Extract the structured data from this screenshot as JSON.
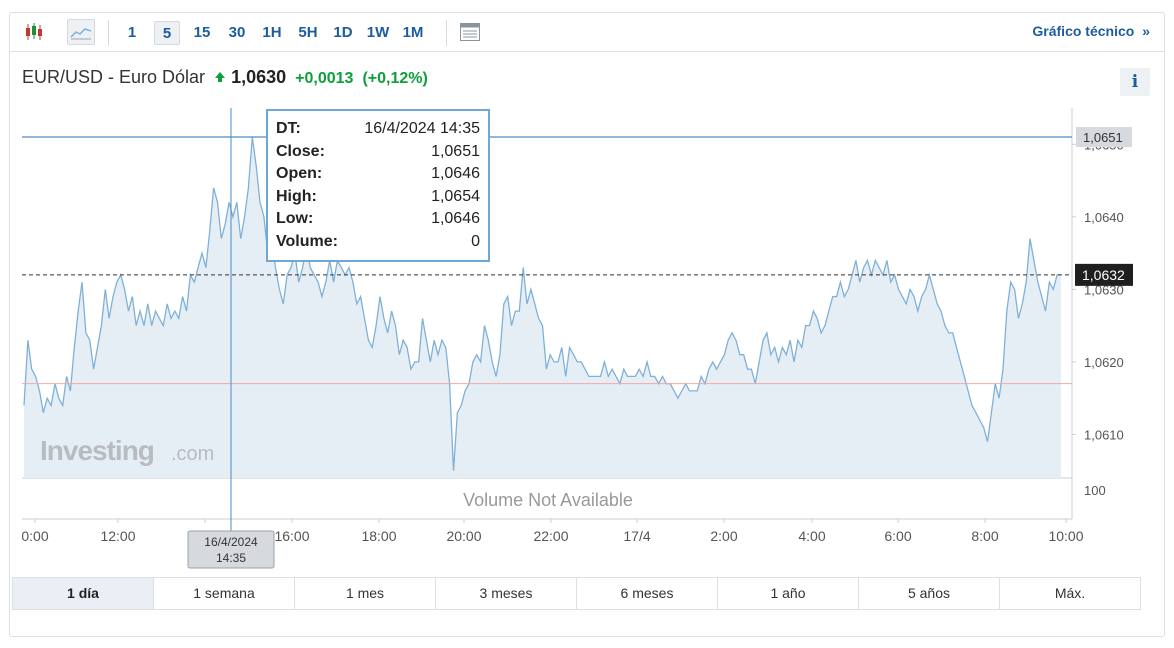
{
  "toolbar": {
    "icons": [
      "candlestick-icon",
      "area-chart-icon",
      "indicators-icon"
    ],
    "timeframes": [
      "1",
      "5",
      "15",
      "30",
      "1H",
      "5H",
      "1D",
      "1W",
      "1M"
    ],
    "active_timeframe": "5",
    "technical_link": "Gráfico técnico",
    "technical_arrow": "»"
  },
  "header": {
    "instrument": "EUR/USD - Euro Dólar",
    "price": "1,0630",
    "change": "+0,0013",
    "change_pct": "(+0,12%)",
    "info_label": "i"
  },
  "watermark": {
    "brand": "Investing",
    "suffix": ".com"
  },
  "volume_label": "Volume Not Available",
  "tooltip": {
    "rows": [
      {
        "k": "DT:",
        "v": "16/4/2024 14:35"
      },
      {
        "k": "Close:",
        "v": "1,0651"
      },
      {
        "k": "Open:",
        "v": "1,0646"
      },
      {
        "k": "High:",
        "v": "1,0654"
      },
      {
        "k": "Low:",
        "v": "1,0646"
      },
      {
        "k": "Volume:",
        "v": "0"
      }
    ]
  },
  "crosshair_label": {
    "date": "16/4/2024",
    "time": "14:35"
  },
  "range_tabs": [
    "1 día",
    "1 semana",
    "1 mes",
    "3 meses",
    "6 meses",
    "1 año",
    "5 años",
    "Máx."
  ],
  "active_range": "1 día",
  "colors": {
    "line": "#7fb1d8",
    "fill": "#e6eef5",
    "crosshair": "#4a8cc4",
    "prev_close": "#f2a8a8",
    "accent": "#1d5c9f",
    "up": "#0e9e3a"
  },
  "chart_data": {
    "type": "area",
    "y_ticks": [
      "1,0610",
      "1,0620",
      "1,0630",
      "1,0640",
      "1,0650"
    ],
    "ylim": [
      1.0604,
      1.0655
    ],
    "volume_tick": "100",
    "x_ticks": [
      {
        "label": "0:00",
        "hours": 0
      },
      {
        "label": "12:00",
        "hours": 12
      },
      {
        "label": "14:00",
        "hours": 14
      },
      {
        "label": "16:00",
        "hours": 16
      },
      {
        "label": "18:00",
        "hours": 18
      },
      {
        "label": "20:00",
        "hours": 20
      },
      {
        "label": "22:00",
        "hours": 22
      },
      {
        "label": "17/4",
        "hours": 24
      },
      {
        "label": "2:00",
        "hours": 26
      },
      {
        "label": "4:00",
        "hours": 28
      },
      {
        "label": "6:00",
        "hours": 30
      },
      {
        "label": "8:00",
        "hours": 32
      },
      {
        "label": "10:00",
        "hours": 34
      }
    ],
    "crosshair_hours": 14.583,
    "crosshair_value": 1.0651,
    "crosshair_value_label": "1,0651",
    "current_value": 1.0632,
    "current_value_label": "1,0632",
    "prev_close_value": 1.0617,
    "series": [
      {
        "values": [
          1.0614,
          1.0623,
          1.0619,
          1.0618,
          1.0616,
          1.0613,
          1.0615,
          1.0614,
          1.0617,
          1.0615,
          1.0614,
          1.0618,
          1.0616,
          1.0622,
          1.0627,
          1.0631,
          1.0624,
          1.0623,
          1.0619,
          1.0622,
          1.0625,
          1.063,
          1.0626,
          1.0629,
          1.0631,
          1.0632,
          1.063,
          1.0627,
          1.0629,
          1.0625,
          1.0627,
          1.0625,
          1.0628,
          1.0625,
          1.0627,
          1.0626,
          1.0625,
          1.0628,
          1.0626,
          1.0627,
          1.0626,
          1.0629,
          1.0627,
          1.0632,
          1.0631,
          1.0633,
          1.0635,
          1.0633,
          1.0638,
          1.0644,
          1.0642,
          1.0637,
          1.0639,
          1.0642,
          1.064,
          1.0642,
          1.0637,
          1.064,
          1.0644,
          1.0651,
          1.0647,
          1.0642,
          1.064,
          1.0635,
          1.0637,
          1.0633,
          1.063,
          1.0628,
          1.0632,
          1.0633,
          1.0635,
          1.0631,
          1.0633,
          1.0636,
          1.0633,
          1.0632,
          1.0631,
          1.0629,
          1.0631,
          1.0634,
          1.0631,
          1.0634,
          1.0633,
          1.0632,
          1.0633,
          1.0631,
          1.0628,
          1.0629,
          1.0626,
          1.0623,
          1.0622,
          1.0625,
          1.0629,
          1.0626,
          1.0624,
          1.0627,
          1.0625,
          1.0621,
          1.0623,
          1.0622,
          1.0619,
          1.062,
          1.062,
          1.0626,
          1.0623,
          1.062,
          1.0623,
          1.0621,
          1.0623,
          1.0622,
          1.0617,
          1.0605,
          1.0613,
          1.0614,
          1.0616,
          1.0617,
          1.062,
          1.0621,
          1.062,
          1.0625,
          1.0623,
          1.062,
          1.0618,
          1.0621,
          1.0628,
          1.0629,
          1.0625,
          1.0627,
          1.0627,
          1.0633,
          1.0628,
          1.063,
          1.0628,
          1.0626,
          1.0625,
          1.0619,
          1.0621,
          1.062,
          1.062,
          1.0622,
          1.0618,
          1.0622,
          1.0621,
          1.062,
          1.062,
          1.0619,
          1.0618,
          1.0618,
          1.0618,
          1.0618,
          1.062,
          1.0618,
          1.0619,
          1.0618,
          1.0617,
          1.0619,
          1.0618,
          1.0618,
          1.0618,
          1.0619,
          1.0618,
          1.062,
          1.0618,
          1.0618,
          1.0617,
          1.0618,
          1.0617,
          1.0617,
          1.0616,
          1.0615,
          1.0616,
          1.0617,
          1.0616,
          1.0616,
          1.0616,
          1.0618,
          1.0617,
          1.0619,
          1.062,
          1.0619,
          1.062,
          1.0621,
          1.0623,
          1.0624,
          1.0623,
          1.0621,
          1.0621,
          1.0619,
          1.0619,
          1.0617,
          1.062,
          1.0623,
          1.0624,
          1.0621,
          1.0622,
          1.062,
          1.0622,
          1.0621,
          1.0623,
          1.062,
          1.0623,
          1.0622,
          1.0625,
          1.0625,
          1.0627,
          1.0626,
          1.0624,
          1.0625,
          1.0627,
          1.0629,
          1.0629,
          1.0631,
          1.0629,
          1.063,
          1.0632,
          1.0634,
          1.0631,
          1.0633,
          1.0634,
          1.0632,
          1.0634,
          1.0633,
          1.0632,
          1.0634,
          1.0631,
          1.0632,
          1.063,
          1.0629,
          1.0628,
          1.063,
          1.0629,
          1.0627,
          1.0629,
          1.063,
          1.0632,
          1.063,
          1.0628,
          1.0627,
          1.0625,
          1.0624,
          1.0624,
          1.0622,
          1.062,
          1.0618,
          1.0616,
          1.0614,
          1.0613,
          1.0612,
          1.0611,
          1.0609,
          1.0613,
          1.0617,
          1.0615,
          1.0619,
          1.0627,
          1.0631,
          1.063,
          1.0626,
          1.0628,
          1.0631,
          1.0637,
          1.0634,
          1.0631,
          1.0629,
          1.0627,
          1.0631,
          1.063,
          1.0632,
          1.0632
        ]
      }
    ]
  }
}
